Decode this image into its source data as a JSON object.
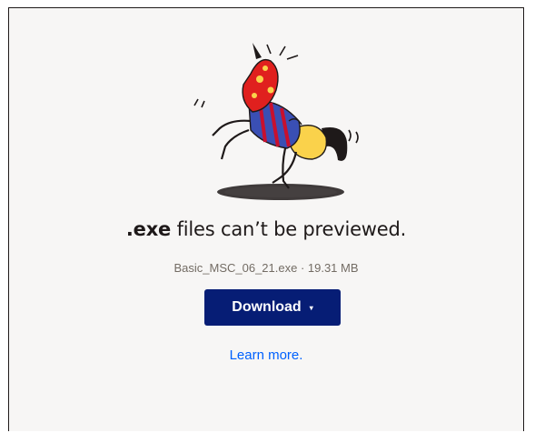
{
  "preview": {
    "heading_ext": ".exe",
    "heading_rest": " files can’t be previewed.",
    "file_meta": "Basic_MSC_06_21.exe · 19.31 MB",
    "download_label": "Download",
    "download_caret": "▾",
    "learn_more": "Learn more."
  },
  "icons": {
    "illustration": "rearing-horse-illustration",
    "dropdown": "caret-down-icon"
  },
  "colors": {
    "button": "#061d75",
    "link": "#0061fe",
    "background": "#f7f6f5",
    "text": "#1e1919",
    "muted": "#736c64"
  }
}
